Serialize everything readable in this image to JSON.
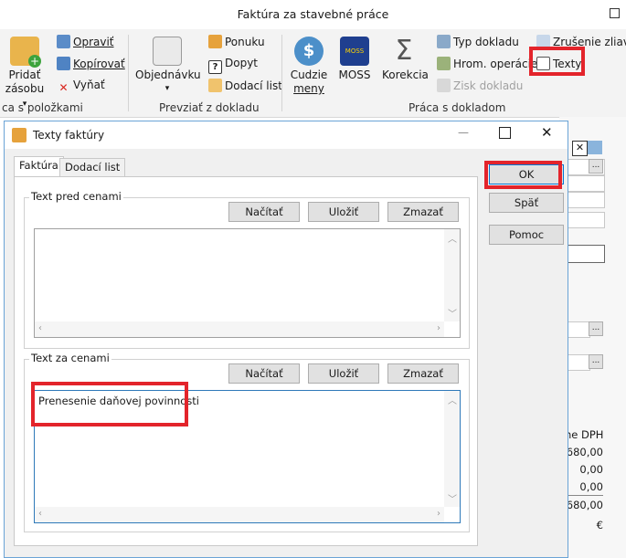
{
  "main_window": {
    "title": "Faktúra za stavebné práce"
  },
  "ribbon": {
    "group1": {
      "big_button": {
        "label1": "Pridať",
        "label2": "zásobu",
        "arrow": "▾"
      },
      "opravit": "Opraviť",
      "kopirovat": "Kopírovať",
      "vynat": "Vyňať",
      "group_label": "ca s položkami"
    },
    "group2": {
      "big_button": {
        "label": "Objednávku",
        "arrow": "▾"
      },
      "ponuku": "Ponuku",
      "dopyt": "Dopyt",
      "dodaci_list": "Dodací list",
      "group_label": "Prevziať z dokladu"
    },
    "group3": {
      "cudzie_meny": {
        "label1": "Cudzie",
        "label2": "meny"
      },
      "moss": {
        "label": "MOSS",
        "icon_text": "MOSS"
      },
      "korekcia": {
        "label": "Korekcia"
      },
      "typ_dokladu": "Typ dokladu",
      "hrom_operacie": "Hrom. operácie",
      "zisk_dokladu": "Zisk dokladu",
      "zrusenie_zliav": "Zrušenie zliav",
      "texty": "Texty",
      "group_label": "Práca s dokladom"
    }
  },
  "right_panel": {
    "col_header": "ne DPH",
    "values": [
      "680,00",
      "0,00",
      "0,00",
      "680,00"
    ],
    "currency": "€",
    "ellipsis": "..."
  },
  "dialog": {
    "title": "Texty faktúry",
    "minimize_glyph": "—",
    "maximize_glyph": "☐",
    "close_glyph": "✕",
    "tabs": [
      {
        "label": "Faktúra",
        "active": true
      },
      {
        "label": "Dodací list",
        "active": false
      }
    ],
    "section1": {
      "label": "Text pred cenami",
      "load": "Načítať",
      "save": "Uložiť",
      "delete": "Zmazať",
      "text": ""
    },
    "section2": {
      "label": "Text za cenami",
      "load": "Načítať",
      "save": "Uložiť",
      "delete": "Zmazať",
      "text": "Prenesenie daňovej povinnosti"
    },
    "buttons": {
      "ok": "OK",
      "back": "Späť",
      "help": "Pomoc"
    }
  },
  "colors": {
    "highlight": "#e3242b",
    "dialog_border": "#6aa3d6",
    "focus_border": "#2e79b9"
  }
}
